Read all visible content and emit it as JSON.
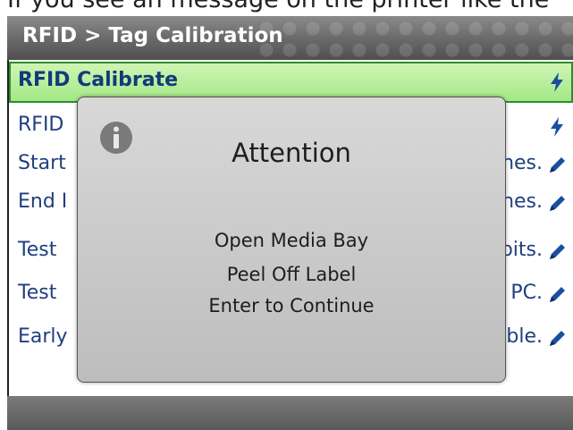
{
  "caption": "If you see an message on the printer like the",
  "header": {
    "title": "RFID > Tag Calibration"
  },
  "list": {
    "items": [
      {
        "label": "RFID Calibrate",
        "value": "",
        "icon": "lightning-icon",
        "selected": true
      },
      {
        "label": "RFID",
        "value": "",
        "icon": "lightning-icon",
        "selected": false
      },
      {
        "label": "Start",
        "value": "nes.",
        "icon": "pencil-icon",
        "selected": false
      },
      {
        "label": "End I",
        "value": "nes.",
        "icon": "pencil-icon",
        "selected": false
      },
      {
        "label": "Test",
        "value": "bits.",
        "icon": "pencil-icon",
        "selected": false
      },
      {
        "label": "Test",
        "value": "PC.",
        "icon": "pencil-icon",
        "selected": false
      },
      {
        "label": "Early",
        "value": "ble.",
        "icon": "pencil-icon",
        "selected": false
      }
    ]
  },
  "dialog": {
    "icon": "info-icon",
    "title": "Attention",
    "lines": [
      "Open Media Bay",
      "Peel Off Label",
      "Enter to Continue"
    ]
  },
  "colors": {
    "accent": "#1f3f7f",
    "selected_bg": "#b6ee98",
    "icon_blue": "#1a4fa0"
  }
}
